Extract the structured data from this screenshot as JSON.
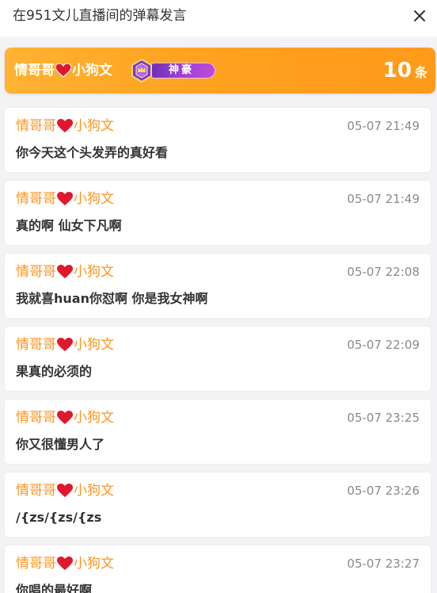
{
  "window": {
    "title": "在951文儿直播间的弹幕发言",
    "close_icon": "close-icon"
  },
  "summary": {
    "user_prefix": "情哥哥",
    "heart_icon": "heart-icon",
    "user_suffix": "小狗文",
    "badge_label": "神豪",
    "count": "10",
    "count_unit": "条",
    "banner_color": "#ffa21f"
  },
  "messages": [
    {
      "user_prefix": "情哥哥",
      "user_suffix": "小狗文",
      "time": "05-07 21:49",
      "text": "你今天这个头发弄的真好看"
    },
    {
      "user_prefix": "情哥哥",
      "user_suffix": "小狗文",
      "time": "05-07 21:49",
      "text": "真的啊 仙女下凡啊"
    },
    {
      "user_prefix": "情哥哥",
      "user_suffix": "小狗文",
      "time": "05-07 22:08",
      "text": "我就喜huan你怼啊 你是我女神啊"
    },
    {
      "user_prefix": "情哥哥",
      "user_suffix": "小狗文",
      "time": "05-07 22:09",
      "text": "果真的必须的"
    },
    {
      "user_prefix": "情哥哥",
      "user_suffix": "小狗文",
      "time": "05-07 23:25",
      "text": "你又很懂男人了"
    },
    {
      "user_prefix": "情哥哥",
      "user_suffix": "小狗文",
      "time": "05-07 23:26",
      "text": "/{zs/{zs/{zs"
    },
    {
      "user_prefix": "情哥哥",
      "user_suffix": "小狗文",
      "time": "05-07 23:27",
      "text": "你唱的最好啊"
    }
  ],
  "colors": {
    "username": "#ff9520",
    "timestamp": "#8a8a8a",
    "heart": "#e0182d"
  }
}
